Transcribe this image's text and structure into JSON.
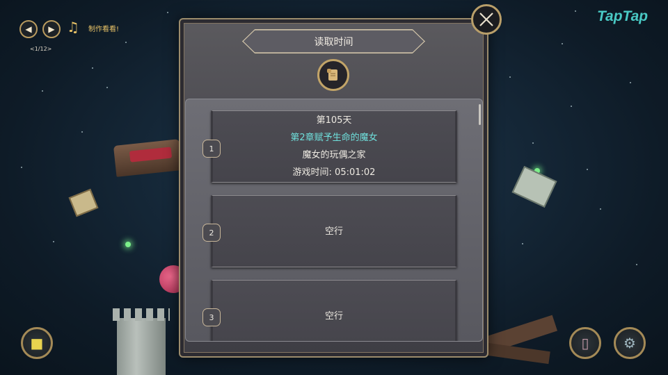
{
  "top_left": {
    "prev_icon": "chevron-left-icon",
    "next_icon": "chevron-right-icon",
    "music_icon": "music-note-icon",
    "track_title": "制作看看!",
    "track_counter": "<1/12>"
  },
  "brand": {
    "logo_text": "TapTap",
    "color": "#49c9c4"
  },
  "dialog": {
    "title": "读取时间",
    "close_icon": "close-icon",
    "emblem_icon": "scroll-icon",
    "slots": [
      {
        "number": "1",
        "day": "第105天",
        "chapter": "第2章赋予生命的魔女",
        "location": "魔女的玩偶之家",
        "playtime": "游戏时间:  05:01:02",
        "empty": false
      },
      {
        "number": "2",
        "empty_label": "空行",
        "empty": true
      },
      {
        "number": "3",
        "empty_label": "空行",
        "empty": true
      }
    ]
  },
  "bottom_controls": {
    "left_icon": "character-icon",
    "book_icon": "book-icon",
    "settings_icon": "gear-icon"
  },
  "colors": {
    "accent_gold": "#c2a468",
    "chapter_cyan": "#6fe0dc",
    "panel_bg": "#4a4950"
  }
}
